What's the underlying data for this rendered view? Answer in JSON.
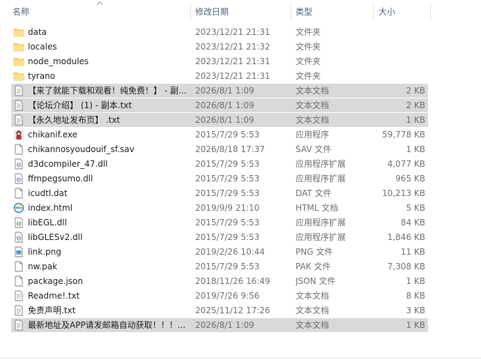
{
  "columns": {
    "name": "名称",
    "date": "修改日期",
    "type": "类型",
    "size": "大小"
  },
  "files": [
    {
      "icon": "folder-icon",
      "name": "data",
      "date": "2023/12/21 21:31",
      "type": "文件夹",
      "size": "",
      "selected": false
    },
    {
      "icon": "folder-icon",
      "name": "locales",
      "date": "2023/12/21 21:32",
      "type": "文件夹",
      "size": "",
      "selected": false
    },
    {
      "icon": "folder-icon",
      "name": "node_modules",
      "date": "2023/12/21 21:31",
      "type": "文件夹",
      "size": "",
      "selected": false
    },
    {
      "icon": "folder-icon",
      "name": "tyrano",
      "date": "2023/12/21 21:31",
      "type": "文件夹",
      "size": "",
      "selected": false
    },
    {
      "icon": "text-file-icon",
      "name": "【来了就能下载和观看！纯免费！】 - 副...",
      "date": "2026/8/1 1:09",
      "type": "文本文档",
      "size": "2 KB",
      "selected": true
    },
    {
      "icon": "text-file-icon",
      "name": "【论坛介绍】 (1) - 副本.txt",
      "date": "2026/8/1 1:09",
      "type": "文本文档",
      "size": "2 KB",
      "selected": true
    },
    {
      "icon": "text-file-icon",
      "name": "【永久地址发布页】 .txt",
      "date": "2026/8/1 1:09",
      "type": "文本文档",
      "size": "1 KB",
      "selected": true
    },
    {
      "icon": "app-exe-icon",
      "name": "chikanif.exe",
      "date": "2015/7/29 5:53",
      "type": "应用程序",
      "size": "59,778 KB",
      "selected": false
    },
    {
      "icon": "generic-file-icon",
      "name": "chikannosyoudouif_sf.sav",
      "date": "2026/8/18 17:37",
      "type": "SAV 文件",
      "size": "1 KB",
      "selected": false
    },
    {
      "icon": "dll-file-icon",
      "name": "d3dcompiler_47.dll",
      "date": "2015/7/29 5:53",
      "type": "应用程序扩展",
      "size": "4,077 KB",
      "selected": false
    },
    {
      "icon": "dll-file-icon",
      "name": "ffmpegsumo.dll",
      "date": "2015/7/29 5:53",
      "type": "应用程序扩展",
      "size": "965 KB",
      "selected": false
    },
    {
      "icon": "generic-file-icon",
      "name": "icudtl.dat",
      "date": "2015/7/29 5:53",
      "type": "DAT 文件",
      "size": "10,213 KB",
      "selected": false
    },
    {
      "icon": "html-file-icon",
      "name": "index.html",
      "date": "2019/9/9 21:10",
      "type": "HTML 文档",
      "size": "5 KB",
      "selected": false
    },
    {
      "icon": "dll-file-icon",
      "name": "libEGL.dll",
      "date": "2015/7/29 5:53",
      "type": "应用程序扩展",
      "size": "84 KB",
      "selected": false
    },
    {
      "icon": "dll-file-icon",
      "name": "libGLESv2.dll",
      "date": "2015/7/29 5:53",
      "type": "应用程序扩展",
      "size": "1,846 KB",
      "selected": false
    },
    {
      "icon": "image-file-icon",
      "name": "link.png",
      "date": "2019/2/26 10:44",
      "type": "PNG 文件",
      "size": "11 KB",
      "selected": false
    },
    {
      "icon": "generic-file-icon",
      "name": "nw.pak",
      "date": "2015/7/29 5:53",
      "type": "PAK 文件",
      "size": "7,308 KB",
      "selected": false
    },
    {
      "icon": "generic-file-icon",
      "name": "package.json",
      "date": "2018/11/26 16:49",
      "type": "JSON 文件",
      "size": "1 KB",
      "selected": false
    },
    {
      "icon": "text-file-icon",
      "name": "Readme!.txt",
      "date": "2019/7/26 9:56",
      "type": "文本文档",
      "size": "8 KB",
      "selected": false
    },
    {
      "icon": "text-file-icon",
      "name": "免责声明.txt",
      "date": "2025/11/12 17:26",
      "type": "文本文档",
      "size": "3 KB",
      "selected": false
    },
    {
      "icon": "text-file-icon",
      "name": "最新地址及APP请发邮箱自动获取！！！...",
      "date": "2026/8/1 1:09",
      "type": "文本文档",
      "size": "1 KB",
      "selected": true
    }
  ]
}
